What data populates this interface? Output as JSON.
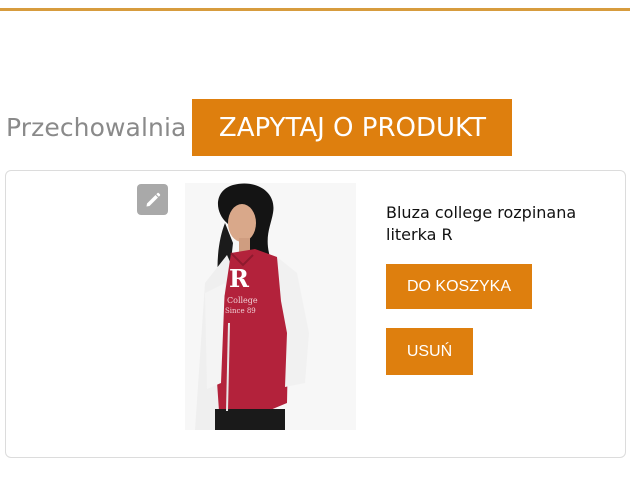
{
  "header": {
    "storage_label": "Przechowalnia",
    "ask_button": "ZAPYTAJ O PRODUKT"
  },
  "item": {
    "name": "Bluza college rozpinana literka R",
    "add_to_cart": "DO KOSZYKA",
    "remove": "USUŃ",
    "edit_icon": "pencil-icon"
  },
  "colors": {
    "accent": "#de7f0e",
    "top_rule": "#d79c3e",
    "muted_text": "#8a8a8a",
    "edit_button": "#a9a9a9"
  }
}
